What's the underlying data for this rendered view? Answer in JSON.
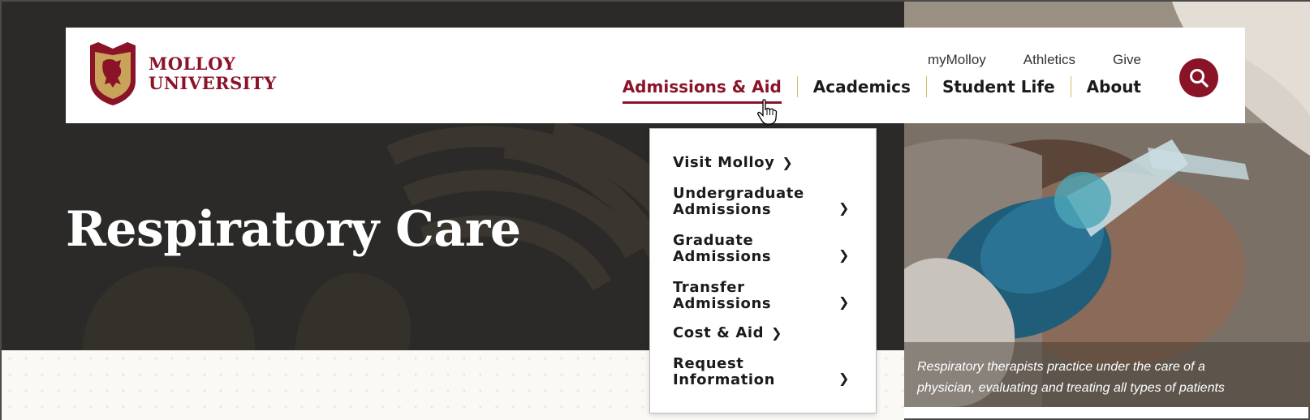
{
  "logo": {
    "line1": "MOLLOY",
    "line2": "UNIVERSITY"
  },
  "utility_nav": [
    "myMolloy",
    "Athletics",
    "Give"
  ],
  "main_nav": [
    "Admissions & Aid",
    "Academics",
    "Student Life",
    "About"
  ],
  "search": {
    "icon": "search-icon"
  },
  "dropdown": {
    "items": [
      {
        "lines": [
          "Visit Molloy"
        ]
      },
      {
        "lines": [
          "Undergraduate",
          "Admissions"
        ]
      },
      {
        "lines": [
          "Graduate",
          "Admissions"
        ]
      },
      {
        "lines": [
          "Transfer",
          "Admissions"
        ]
      },
      {
        "lines": [
          "Cost & Aid"
        ]
      },
      {
        "lines": [
          "Request",
          "Information"
        ]
      }
    ]
  },
  "hero": {
    "title": "Respiratory Care",
    "caption": "Respiratory therapists practice under the care of a physician, evaluating and treating all types of patients"
  },
  "colors": {
    "brand": "#8b1328",
    "gold": "#c9a35a",
    "hero_dark": "#2b2a28"
  }
}
